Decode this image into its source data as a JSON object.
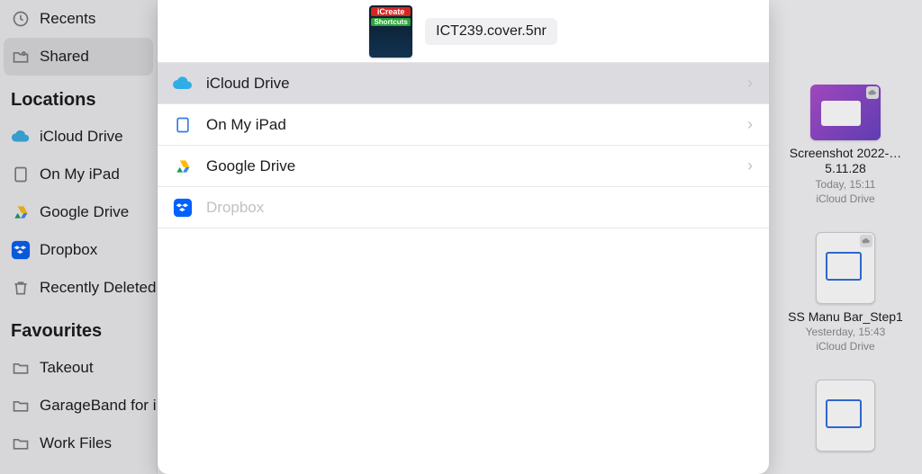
{
  "sidebar": {
    "top": [
      {
        "label": "Recents",
        "icon": "clock"
      },
      {
        "label": "Shared",
        "icon": "share",
        "selected": true
      }
    ],
    "locationsHeader": "Locations",
    "locations": [
      {
        "label": "iCloud Drive",
        "icon": "icloud"
      },
      {
        "label": "On My iPad",
        "icon": "ipad"
      },
      {
        "label": "Google Drive",
        "icon": "gdrive"
      },
      {
        "label": "Dropbox",
        "icon": "dropbox"
      },
      {
        "label": "Recently Deleted",
        "icon": "trash"
      }
    ],
    "favouritesHeader": "Favourites",
    "favourites": [
      {
        "label": "Takeout"
      },
      {
        "label": "GarageBand for i"
      },
      {
        "label": "Work Files"
      }
    ]
  },
  "sheet": {
    "fileName": "ICT239.cover.5nr",
    "coverTop": "iCreate",
    "coverMid": "Shortcuts",
    "rows": [
      {
        "label": "iCloud Drive",
        "icon": "icloud",
        "selected": true,
        "chevron": true
      },
      {
        "label": "On My iPad",
        "icon": "ipad",
        "selected": false,
        "chevron": true
      },
      {
        "label": "Google Drive",
        "icon": "gdrive",
        "selected": false,
        "chevron": true
      },
      {
        "label": "Dropbox",
        "icon": "dropbox",
        "selected": false,
        "chevron": false,
        "disabled": true
      }
    ]
  },
  "right": [
    {
      "kind": "image",
      "title": "Screenshot 2022-…5.11.28",
      "sub1": "Today, 15:11",
      "sub2": "iCloud Drive"
    },
    {
      "kind": "doc",
      "title": "SS Manu Bar_Step1",
      "sub1": "Yesterday, 15:43",
      "sub2": "iCloud Drive"
    },
    {
      "kind": "doc",
      "title": "",
      "sub1": "",
      "sub2": ""
    }
  ]
}
